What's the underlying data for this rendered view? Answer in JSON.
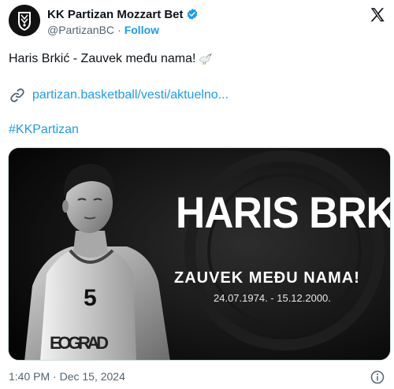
{
  "account": {
    "display_name": "KK Partizan Mozzart Bet",
    "handle": "@PartizanBC",
    "separator": "·",
    "follow_label": "Follow"
  },
  "tweet": {
    "text": "Haris Brkić - Zauvek među nama!",
    "link": "partizan.basketball/vesti/aktuelno...",
    "hashtag": "#KKPartizan",
    "timestamp": "1:40 PM · Dec 15, 2024"
  },
  "poster": {
    "name": "HARIS BRKIĆ",
    "subtitle": "ZAUVEK MEĐU NAMA!",
    "dates": "24.07.1974. - 15.12.2000.",
    "jersey_number": "5",
    "jersey_text": "EOGRAD"
  },
  "icons": {
    "avatar": "partizan-crest",
    "verified": "verified-badge-icon",
    "platform": "x-logo-icon",
    "dove": "dove-emoji",
    "link": "link-icon",
    "info": "info-icon"
  },
  "colors": {
    "link_blue": "#1d9bf0",
    "text": "#0f1419",
    "muted": "#536471"
  }
}
